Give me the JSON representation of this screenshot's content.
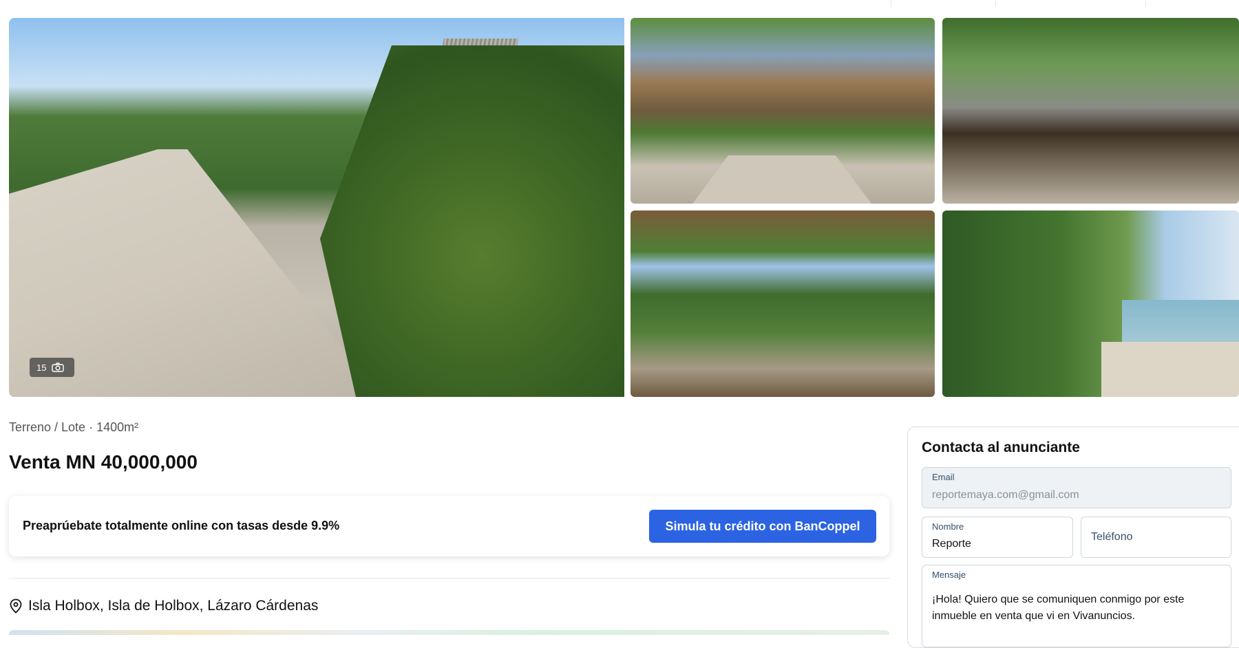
{
  "gallery": {
    "photo_count": "15",
    "photos": [
      "main",
      "thumb-1",
      "thumb-2",
      "thumb-3",
      "thumb-4"
    ]
  },
  "listing": {
    "subtitle": "Terreno / Lote · 1400m²",
    "price": "Venta MN 40,000,000",
    "location": "Isla Holbox, Isla de Holbox, Lázaro Cárdenas"
  },
  "credit": {
    "text": "Preaprúebate totalmente online con tasas desde 9.9%",
    "button": "Simula tu crédito con BanCoppel",
    "button_color": "#2b63e3"
  },
  "contact": {
    "title": "Contacta al anunciante",
    "email_label": "Email",
    "email_value": "reportemaya.com@gmail.com",
    "nombre_label": "Nombre",
    "nombre_value": "Reporte",
    "telefono_placeholder": "Teléfono",
    "mensaje_label": "Mensaje",
    "mensaje_value": "¡Hola! Quiero que se comuniquen conmigo por este inmueble en venta que vi en Vivanuncios."
  },
  "icons": {
    "photos": "camera-icon",
    "location": "map-pin-icon"
  }
}
